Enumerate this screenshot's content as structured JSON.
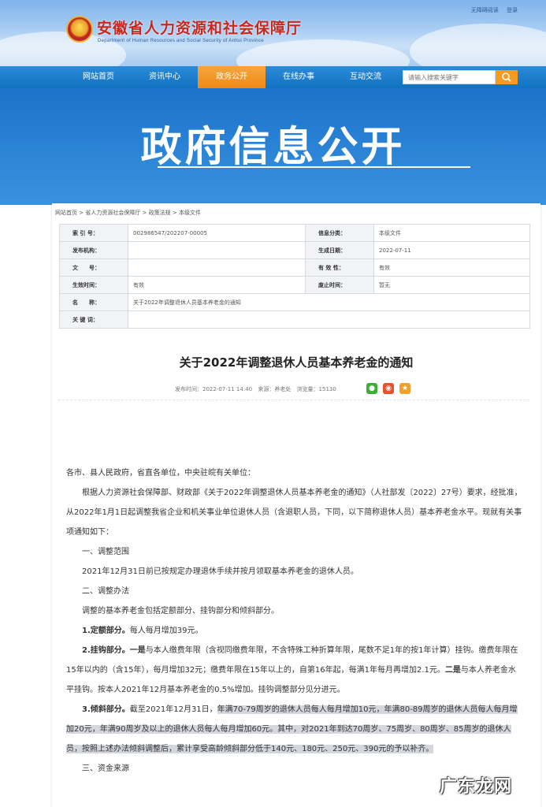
{
  "header": {
    "site_title": "安徽省人力资源和社会保障厅",
    "site_subtitle": "Department of Human Resources and Social Security of Anhui Province",
    "links": [
      "无障碍阅读",
      "登录"
    ]
  },
  "nav": {
    "items": [
      {
        "label": "网站首页",
        "active": false
      },
      {
        "label": "资讯中心",
        "active": false
      },
      {
        "label": "政务公开",
        "active": true
      },
      {
        "label": "在线办事",
        "active": false
      },
      {
        "label": "互动交流",
        "active": false
      }
    ],
    "search_placeholder": "请输入搜索关键字"
  },
  "hero": {
    "title": "政府信息公开"
  },
  "breadcrumb": "网站首页 > 省人力资源社会保障厅 > 政策法规 > 本级文件",
  "meta": {
    "index_no_label": "索 引 号：",
    "index_no": "002986547/202207-00005",
    "category_label": "信息分类：",
    "category": "本级文件",
    "issuer_label": "发布机构：",
    "issuer": "",
    "date_label": "生成日期：",
    "date": "2022-07-11",
    "doc_no_label": "文　　号：",
    "doc_no": "",
    "validity_label": "有 效 性：",
    "validity": "有效",
    "effective_label": "生效时间：",
    "effective": "有效",
    "expire_label": "废止时间：",
    "expire": "暂无",
    "name_label": "名　　称：",
    "name": "关于2022年调整退休人员基本养老金的通知",
    "keywords_label": "关 键 词：",
    "keywords": ""
  },
  "article": {
    "title": "关于2022年调整退休人员基本养老金的通知",
    "published": "发布时间：2022-07-11 14:40",
    "source": "来源：养老处",
    "views": "浏览量：15130",
    "share_colors": {
      "wechat": "#3cb034",
      "weibo": "#e8512c",
      "favorite": "#f0a12a"
    },
    "paragraphs": {
      "p1": "各市、县人民政府，省直各单位，中央驻皖有关单位：",
      "p2": "根据人力资源社会保障部、财政部《关于2022年调整退休人员基本养老金的通知》（人社部发〔2022〕27号）要求，经批准，从2022年1月1日起调整我省企业和机关事业单位退休人员（含退职人员，下同，以下简称退休人员）基本养老金水平。现就有关事项通知如下：",
      "h1": "一、调整范围",
      "p3": "2021年12月31日前已按规定办理退休手续并按月领取基本养老金的退休人员。",
      "h2": "二、调整办法",
      "p4": "调整的基本养老金包括定额部分、挂钩部分和倾斜部分。",
      "p5_bold": "1.定额部分。",
      "p5": "每人每月增加39元。",
      "p6_bold": "2.挂钩部分。一是",
      "p6a": "与本人缴费年限（含视同缴费年限，不含特殊工种折算年限，尾数不足1年的按1年计算）挂钩。缴费年限在15年以内的（含15年），每月增加32元；缴费年限在15年以上的，自第16年起，每满1年每月再增加2.1元。",
      "p6_bold2": "二是",
      "p6b": "与本人养老金水平挂钩。按本人2021年12月基本养老金的0.5%增加。挂钩调整部分见分进元。",
      "p7_bold": "3.倾斜部分。",
      "p7a": "截至2021年12月31日，",
      "p7b": "年满70-79周岁的退休人员每人每月增加10元，年满80-89周岁的退休人员每人每月增加20元，年满90周岁及以上的退休人员每人每月增加60元。其中，对2021年到达70周岁、75周岁、80周岁、85周岁的退休人员，按照上述办法倾斜调整后，累计享受高龄倾斜部分低于140元、180元、250元、390元的予以补齐。",
      "h3": "三、资金来源"
    }
  },
  "watermark": "广东龙网"
}
